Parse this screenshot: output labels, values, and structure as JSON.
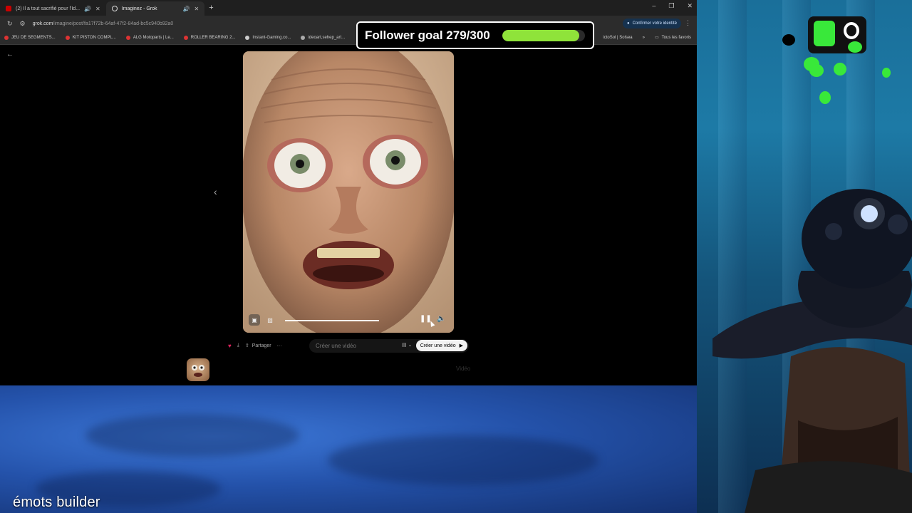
{
  "browser": {
    "tabs": [
      {
        "label": "(2) Il a tout sacrifié pour l'Id..."
      },
      {
        "label": "Imaginez - Grok"
      }
    ],
    "url": {
      "host": "grok.com",
      "path": "/imagine/post/fa17f72b-64af-47f2-84ad-bc5c940b92a0"
    },
    "confirm_identity": "Confirmer votre identité",
    "bookmarks": [
      "JEU DE SEGMENTS...",
      "KIT PISTON COMPL...",
      "ALG Motoparts | Le...",
      "ROLLER BEARING 2...",
      "Instant-Gaming.co...",
      "ideoart,sehep_art..."
    ],
    "bookmarks_right": [
      "ictoSol | Solsea",
      "Tous les favoris"
    ]
  },
  "page": {
    "actions": {
      "share": "Partager",
      "more": "···"
    },
    "prompt_placeholder": "Créer une vidéo",
    "create_button": "Créer une vidéo",
    "ghost_video": "Vidéo",
    "video_progress": 1.0
  },
  "overlay": {
    "goal_text": "Follower goal 279/300",
    "goal_current": 279,
    "goal_target": 300,
    "caption": "émots builder"
  },
  "colors": {
    "goal_fill": "#8fe33a",
    "logo_green": "#39e83a"
  }
}
